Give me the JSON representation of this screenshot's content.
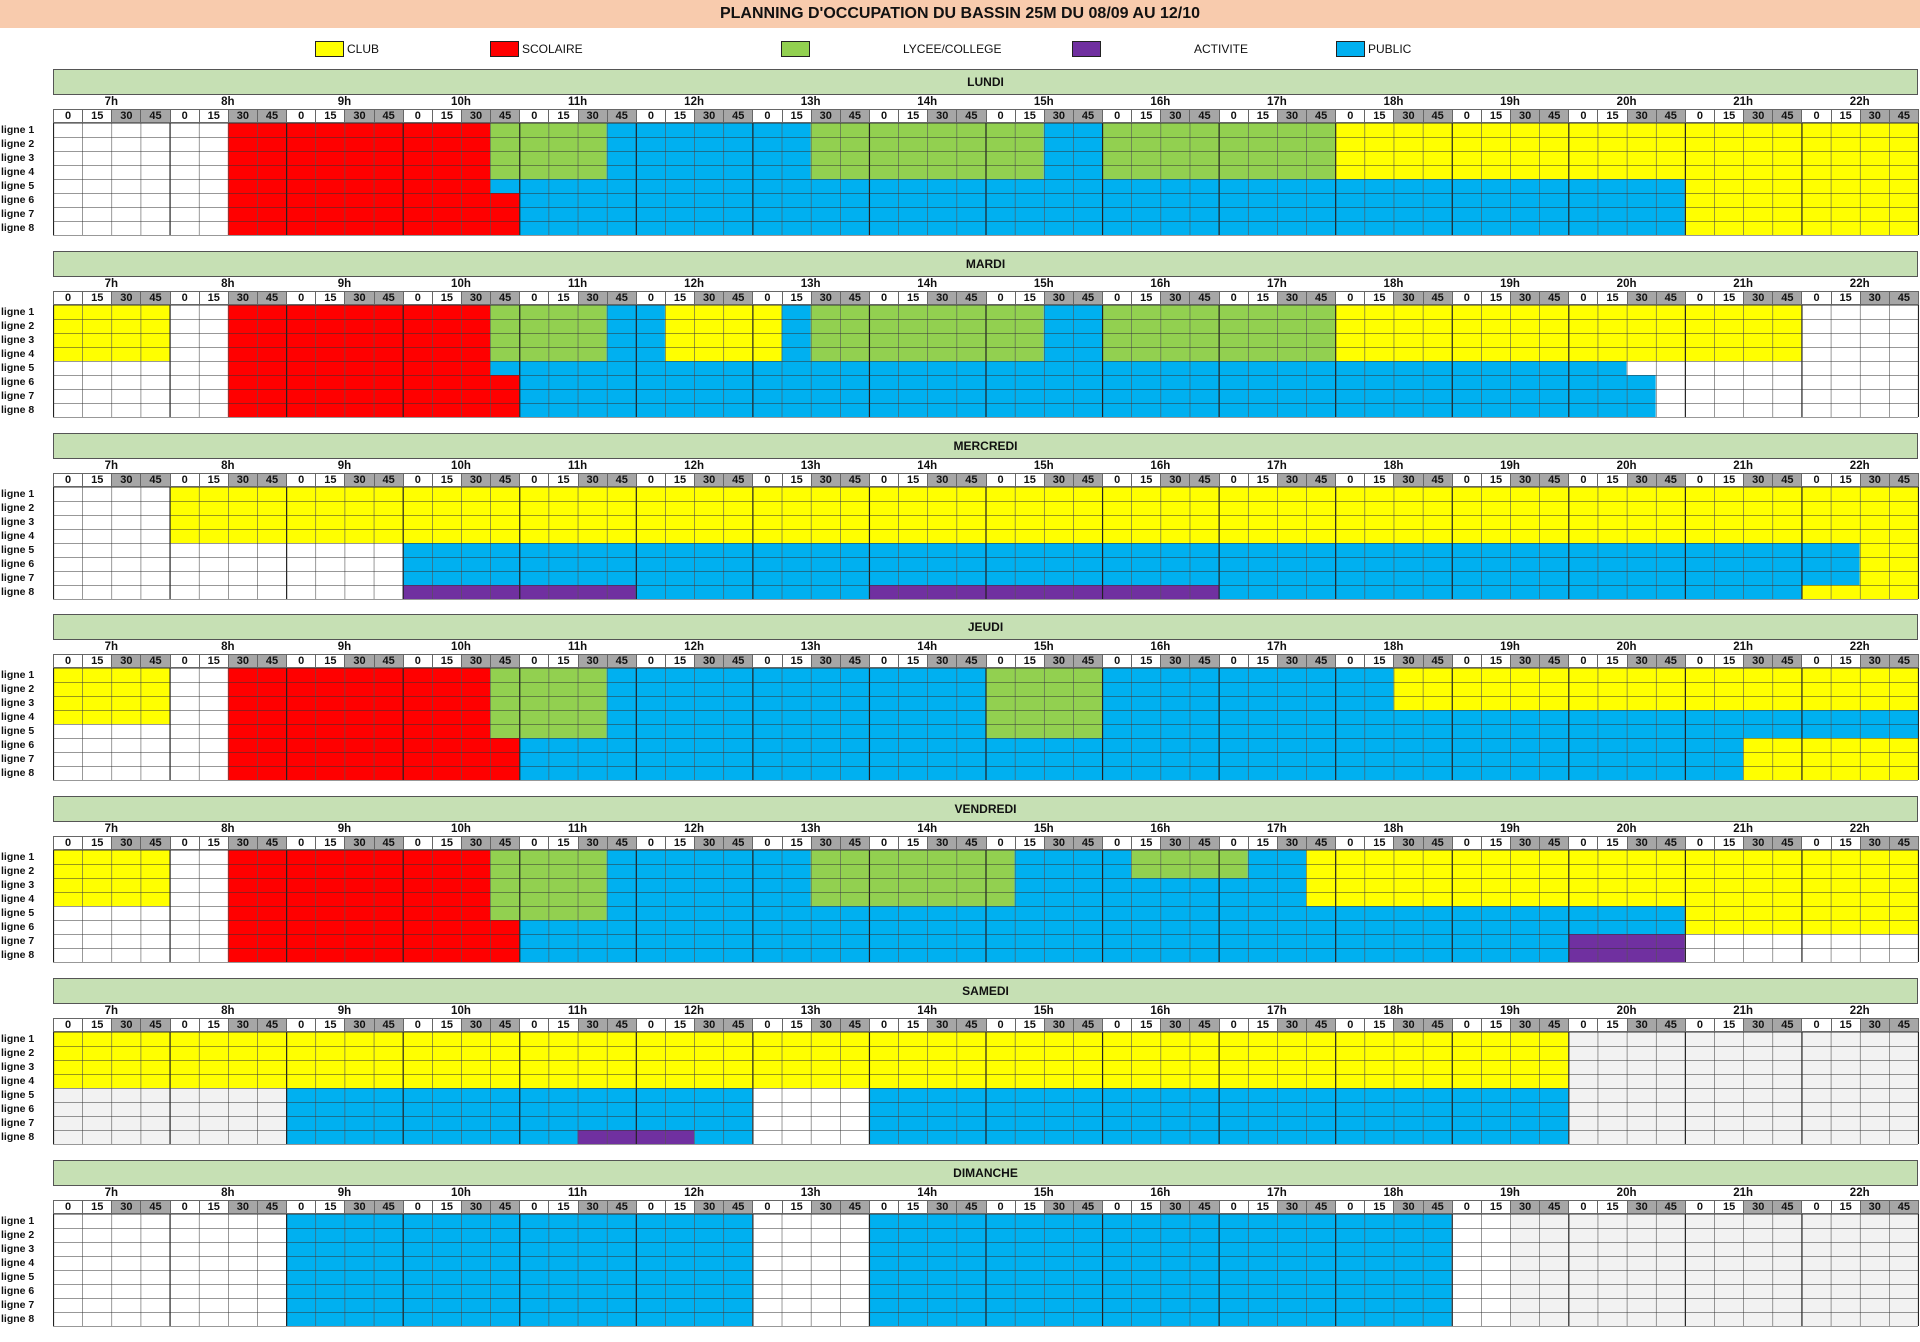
{
  "title": "PLANNING D'OCCUPATION DU BASSIN 25M DU 08/09 AU 12/10",
  "legend": [
    {
      "code": "C",
      "label": "CLUB",
      "color": "#ffff00"
    },
    {
      "code": "S",
      "label": "SCOLAIRE",
      "color": "#ff0000"
    },
    {
      "code": "L",
      "label": "LYCEE/COLLEGE",
      "color": "#92d050"
    },
    {
      "code": "A",
      "label": "ACTIVITE",
      "color": "#7030a0"
    },
    {
      "code": "P",
      "label": "PUBLIC",
      "color": "#00b0f0"
    }
  ],
  "empty_colors": {
    "white": "#ffffff",
    "closed": "#f2f2f2"
  },
  "hours": [
    "7h",
    "8h",
    "9h",
    "10h",
    "11h",
    "12h",
    "13h",
    "14h",
    "15h",
    "16h",
    "17h",
    "18h",
    "19h",
    "20h",
    "21h",
    "22h"
  ],
  "minutes": [
    "0",
    "15",
    "30",
    "45"
  ],
  "lanes": [
    "ligne 1",
    "ligne 2",
    "ligne 3",
    "ligne 4",
    "ligne 5",
    "ligne 6",
    "ligne 7",
    "ligne 8"
  ],
  "days": [
    {
      "name": "LUNDI",
      "lanes": [
        "......SSSSSSSSSLLLLPPPPPPPLLLLLLLLPPLLLLLLLLCCCCCCCCCCCCCCCCCCCCZZZZZZ",
        "......SSSSSSSSSLLLLPPPPPPPLLLLLLLLPPLLLLLLLLCCCCCCCCCCCCCCCCCCCCZZZZZZ",
        "......SSSSSSSSSLLLLPPPPPPPLLLLLLLLPPLLLLLLLLCCCCCCCCCCCCCCCCCCCCZZZZZZ",
        "......SSSSSSSSSLLLLPPPPPPPLLLLLLLLPPLLLLLLLLCCCCCCCCCCCCCCCCCCCCZZZZZZ",
        "......SSSSSSSSSPPPPPPPPPPPPPPPPPPPPPPPPPPPPPPPPPPPPPPPPPCCCCCCCCZZZZZZ",
        "......SSSSSSSSSSPPPPPPPPPPPPPPPPPPPPPPPPPPPPPPPPPPPPPPPPCCCCCCCCZZZZZZ",
        "......SSSSSSSSSSPPPPPPPPPPPPPPPPPPPPPPPPPPPPPPPPPPPPPPPPCCCCCCCCZZZZZZ",
        "......SSSSSSSSSSPPPPPPPPPPPPPPPPPPPPPPPPPPPPPPPPPPPPPPPPCCCCCCCCZZZZZZ"
      ]
    },
    {
      "name": "MARDI",
      "lanes": [
        "CCCC..SSSSSSSSSLLLLPPCCCCPLLLLLLLLPPLLLLLLLLCCCCCCCCCCCCCCCC..........",
        "CCCC..SSSSSSSSSLLLLPPCCCCPLLLLLLLLPPLLLLLLLLCCCCCCCCCCCCCCCC..........",
        "CCCC..SSSSSSSSSLLLLPPCCCCPLLLLLLLLPPLLLLLLLLCCCCCCCCCCCCCCCC..........",
        "CCCC..SSSSSSSSSLLLLPPCCCCPLLLLLLLLPPLLLLLLLLCCCCCCCCCCCCCCCC..........",
        "......SSSSSSSSSPPPPPPPPPPPPPPPPPPPPPPPPPPPPPPPPPPPPPPP..............",
        "......SSSSSSSSSSPPPPPPPPPPPPPPPPPPPPPPPPPPPPPPPPPPPPPPP..............",
        "......SSSSSSSSSSPPPPPPPPPPPPPPPPPPPPPPPPPPPPPPPPPPPPPPP..............",
        "......SSSSSSSSSSPPPPPPPPPPPPPPPPPPPPPPPPPPPPPPPPPPPPPPP.............."
      ]
    },
    {
      "name": "MERCREDI",
      "lanes": [
        "....CCCCCCCCCCCCCCCCCCCCCCCCCCCCCCCCCCCCCCCCCCCCCCCCCCCCCCCCCCCCZZZZZZ",
        "....CCCCCCCCCCCCCCCCCCCCCCCCCCCCCCCCCCCCCCCCCCCCCCCCCCCCCCCCCCCCZZZZZZ",
        "....CCCCCCCCCCCCCCCCCCCCCCCCCCCCCCCCCCCCCCCCCCCCCCCCCCCCCCCCCCCCZZZZZZ",
        "....CCCCCCCCCCCCCCCCCCCCCCCCCCCCCCCCCCCCCCCCCCCCCCCCCCCCCCCCCCCCZZZZZZ",
        "............PPPPPPPPPPPPPPPPPPPPPPPPPPPPPPPPPPPPPPPPPPPPPPPPPPCCCCCCCCZZZZZZ",
        "............PPPPPPPPPPPPPPPPPPPPPPPPPPPPPPPPPPPPPPPPPPPPPPPPPPCCCCCCCCZZZZZZ",
        "............PPPPPPPPPPPPPPPPPPPPPPPPPPPPPPPPPPPPPPPPPPPPPPPPPPCCCCCCCCZZZZZZ",
        "............AAAAAAAAPPPPPPPPAAAAAAAAAAAAPPPPPPPPPPPPPPPPPPPPCCCCCCCCZZZZZZ"
      ]
    },
    {
      "name": "JEUDI",
      "lanes": [
        "CCCC..SSSSSSSSSLLLLPPPPPPPPPPPPPLLLLPPPPPPPPPPCCCCCCCCCCCCCCCCCCCCZZZZZZ",
        "CCCC..SSSSSSSSSLLLLPPPPPPPPPPPPPLLLLPPPPPPPPPPCCCCCCCCCCCCCCCCCCCCZZZZZZ",
        "CCCC..SSSSSSSSSLLLLPPPPPPPPPPPPPLLLLPPPPPPPPPPCCCCCCCCCCCCCCCCCCCCZZZZZZ",
        "CCCC..SSSSSSSSSLLLLPPPPPPPPPPPPPLLLLPPPPPPPPPPPPPPPPPPPPPPPPPPPPPPPPPPPCCCCCCCCZZZZZZ",
        "......SSSSSSSSSLLLLPPPPPPPPPPPPPLLLLPPPPPPPPPPPPPPPPPPPPPPPPPPPPPPPPPPPPCCCCCCCCZZZZZZ",
        "......SSSSSSSSSSPPPPPPPPPPPPPPPPPPPPPPPPPPPPPPPPPPPPPPPPPPCCCCCCCCZZZZZZ",
        "......SSSSSSSSSSPPPPPPPPPPPPPPPPPPPPPPPPPPPPPPPPPPPPPPPPPPCCCCCCCCZZZZZZ",
        "......SSSSSSSSSSPPPPPPPPPPPPPPPPPPPPPPPPPPPPPPPPPPPPPPPPPPCCCCCCCCZZZZZZ"
      ]
    },
    {
      "name": "VENDREDI",
      "lanes": [
        "CCCC..SSSSSSSSSLLLLPPPPPPPLLLLLLLPPPPLLLLPPCCCCCCCCCCCCCCCCCCCCCCCCCCCCZZZZZZ",
        "CCCC..SSSSSSSSSLLLLPPPPPPPLLLLLLLPPPPLLLLPPCCCCCCCCCCCCCCCCCCCCCCCCCCCCZZZZZZ",
        "CCCC..SSSSSSSSSLLLLPPPPPPPLLLLLLLPPPPPPPPPPCCCCCCCCCCCCCCCCCCCCCCCCCCCCZZZZZZ",
        "CCCC..SSSSSSSSSLLLLPPPPPPPLLLLLLLPPPPPPPPPPCCCCCCCCCCCCCCCCCCCCCCCCCCCCZZZZZZ",
        "......SSSSSSSSSLLLLPPPPPPPPPPPPPPPPPPPPPPPPPPPPPPPPPPPPPCCCCCCCCZZZZZZ",
        "......SSSSSSSSSSPPPPPPPPPPPPPPPPPPPPPPPPPPPPPPPPPPPPPPPPCCCCCCCCZZZZZZ",
        "......SSSSSSSSSSPPPPPPPPPPPPPPPPPPPPPPPPPPPPPPPPPPPPAAAA....................",
        "......SSSSSSSSSSPPPPPPPPPPPPPPPPPPPPPPPPPPPPPPPPPPPPAAAA...................."
      ]
    },
    {
      "name": "SAMEDI",
      "lanes": [
        "CCCCCCCCCCCCCCCCCCCCCCCCCCCCCCCCCCCCCCCCCCCCCCCCCCCCZZZZZZZZZZZZZZZZ",
        "CCCCCCCCCCCCCCCCCCCCCCCCCCCCCCCCCCCCCCCCCCCCCCCCCCCCZZZZZZZZZZZZZZZZ",
        "CCCCCCCCCCCCCCCCCCCCCCCCCCCCCCCCCCCCCCCCCCCCCCCCCCCCZZZZZZZZZZZZZZZZ",
        "CCCCCCCCCCCCCCCCCCCCCCCCCCCCCCCCCCCCCCCCCCCCCCCCCCCCZZZZZZZZZZZZZZZZ",
        "ZZZZZZZZPPPPPPPPPPPPPPPP....PPPPPPPPPPPPPPPPPPPPPPPPZZZZZZZZZZZZZZZZZZZZ",
        "ZZZZZZZZPPPPPPPPPPPPPPPP....PPPPPPPPPPPPPPPPPPPPPPPPZZZZZZZZZZZZZZZZZZZZ",
        "ZZZZZZZZPPPPPPPPPPPPPPPP....PPPPPPPPPPPPPPPPPPPPPPPPZZZZZZZZZZZZZZZZZZZZ",
        "ZZZZZZZZPPPPPPPPPPAAAAPP....PPPPPPPPPPPPPPPPPPPPPPPPZZZZZZZZZZZZZZZZZZZZ"
      ]
    },
    {
      "name": "DIMANCHE",
      "lanes": [
        "........PPPPPPPPPPPPPPPP....PPPPPPPPPPPPPPPPPPPP..ZZZZZZZZZZZZZZZZ",
        "........PPPPPPPPPPPPPPPP....PPPPPPPPPPPPPPPPPPPP..ZZZZZZZZZZZZZZZZ",
        "........PPPPPPPPPPPPPPPP....PPPPPPPPPPPPPPPPPPPP..ZZZZZZZZZZZZZZZZ",
        "........PPPPPPPPPPPPPPPP....PPPPPPPPPPPPPPPPPPPP..ZZZZZZZZZZZZZZZZ",
        "........PPPPPPPPPPPPPPPP....PPPPPPPPPPPPPPPPPPPP..ZZZZZZZZZZZZZZZZ",
        "........PPPPPPPPPPPPPPPP....PPPPPPPPPPPPPPPPPPPP..ZZZZZZZZZZZZZZZZ",
        "........PPPPPPPPPPPPPPPP....PPPPPPPPPPPPPPPPPPPP..ZZZZZZZZZZZZZZZZ",
        "........PPPPPPPPPPPPPPPP....PPPPPPPPPPPPPPPPPPPP..ZZZZZZZZZZZZZZZZ"
      ]
    }
  ]
}
